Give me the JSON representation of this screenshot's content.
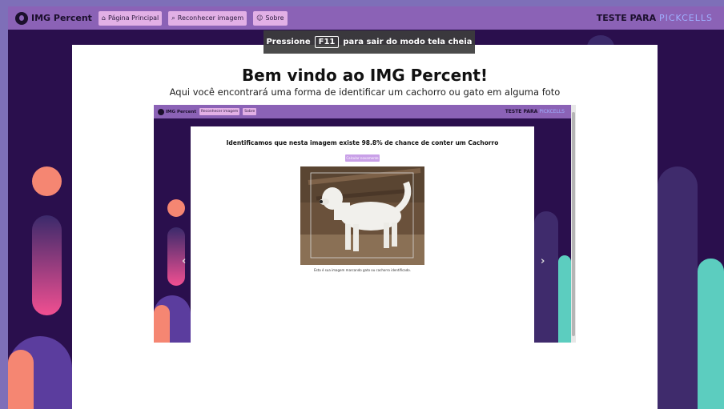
{
  "navbar": {
    "brand": "IMG Percent",
    "items": [
      {
        "icon": "home-icon",
        "glyph": "⌂",
        "label": "Página Principal"
      },
      {
        "icon": "search-icon",
        "glyph": "⌕",
        "label": "Reconhecer imagem"
      },
      {
        "icon": "users-icon",
        "glyph": "☺",
        "label": "Sobre"
      }
    ],
    "test_prefix": "TESTE PARA",
    "test_brand": "PICKCELLS"
  },
  "fullscreen_notice": {
    "prefix": "Pressione",
    "key": "F11",
    "suffix": "para sair do modo tela cheia"
  },
  "main": {
    "title": "Bem vindo ao IMG Percent!",
    "subtitle": "Aqui você encontrará uma forma de identificar um cachorro ou gato em alguma foto"
  },
  "carousel": {
    "slide": {
      "brand": "IMG Percent",
      "nav": [
        "Reconhecer imagem",
        "Sobre"
      ],
      "test_prefix": "TESTE PARA",
      "test_brand": "PICKCELLS",
      "result_text": "Identificamos que nesta imagem existe 98.8% de chance de conter um Cachorro",
      "button_label": "Calcular novamente",
      "caption": "Esta é sua imagem marcando gato ou cachorro identificado."
    },
    "prev": "‹",
    "next": "›"
  },
  "colors": {
    "navbar": "#8b62b6",
    "nav_button": "#e2b0e6",
    "background": "#2a0f4d",
    "accent_pink": "#f14f91",
    "accent_teal": "#5ccdbf",
    "accent_salmon": "#f58672"
  }
}
